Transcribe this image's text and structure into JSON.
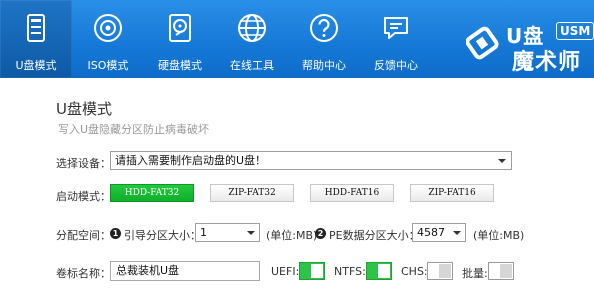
{
  "nav": {
    "items": [
      {
        "label": "U盘模式",
        "icon": "usb-drive-icon",
        "active": true
      },
      {
        "label": "ISO模式",
        "icon": "disc-icon",
        "active": false
      },
      {
        "label": "硬盘模式",
        "icon": "hard-disk-icon",
        "active": false
      },
      {
        "label": "在线工具",
        "icon": "globe-icon",
        "active": false
      },
      {
        "label": "帮助中心",
        "icon": "help-icon",
        "active": false
      },
      {
        "label": "反馈中心",
        "icon": "chat-bubble-icon",
        "active": false
      }
    ]
  },
  "logo": {
    "top": "U盘",
    "badge": "USM",
    "bottom": "魔术师"
  },
  "page": {
    "title": "U盘模式",
    "subtitle": "写入U盘隐藏分区防止病毒破坏"
  },
  "device": {
    "label": "选择设备：",
    "value": "请插入需要制作启动盘的U盘！"
  },
  "boot": {
    "label": "启动模式：",
    "options": [
      {
        "label": "HDD-FAT32",
        "active": true
      },
      {
        "label": "ZIP-FAT32",
        "active": false
      },
      {
        "label": "HDD-FAT16",
        "active": false
      },
      {
        "label": "ZIP-FAT16",
        "active": false
      }
    ]
  },
  "space": {
    "label": "分配空间：",
    "boot_num": "1",
    "boot_label": "引导分区大小：",
    "boot_value": "1",
    "boot_unit": "(单位:MB)",
    "pe_num": "2",
    "pe_label": "PE数据分区大小：",
    "pe_value": "4587",
    "pe_unit": "(单位:MB)"
  },
  "volume": {
    "label": "卷标名称：",
    "value": "总裁装机U盘",
    "uefi_label": "UEFI:",
    "ntfs_label": "NTFS:",
    "chs_label": "CHS:",
    "batch_label": "批量:",
    "uefi_on": true,
    "ntfs_on": true,
    "chs_on": false,
    "batch_on": false
  },
  "colors": {
    "topbar": "#1578d6",
    "active_nav": "#0d5aa6",
    "accent_green": "#1fbf38"
  }
}
